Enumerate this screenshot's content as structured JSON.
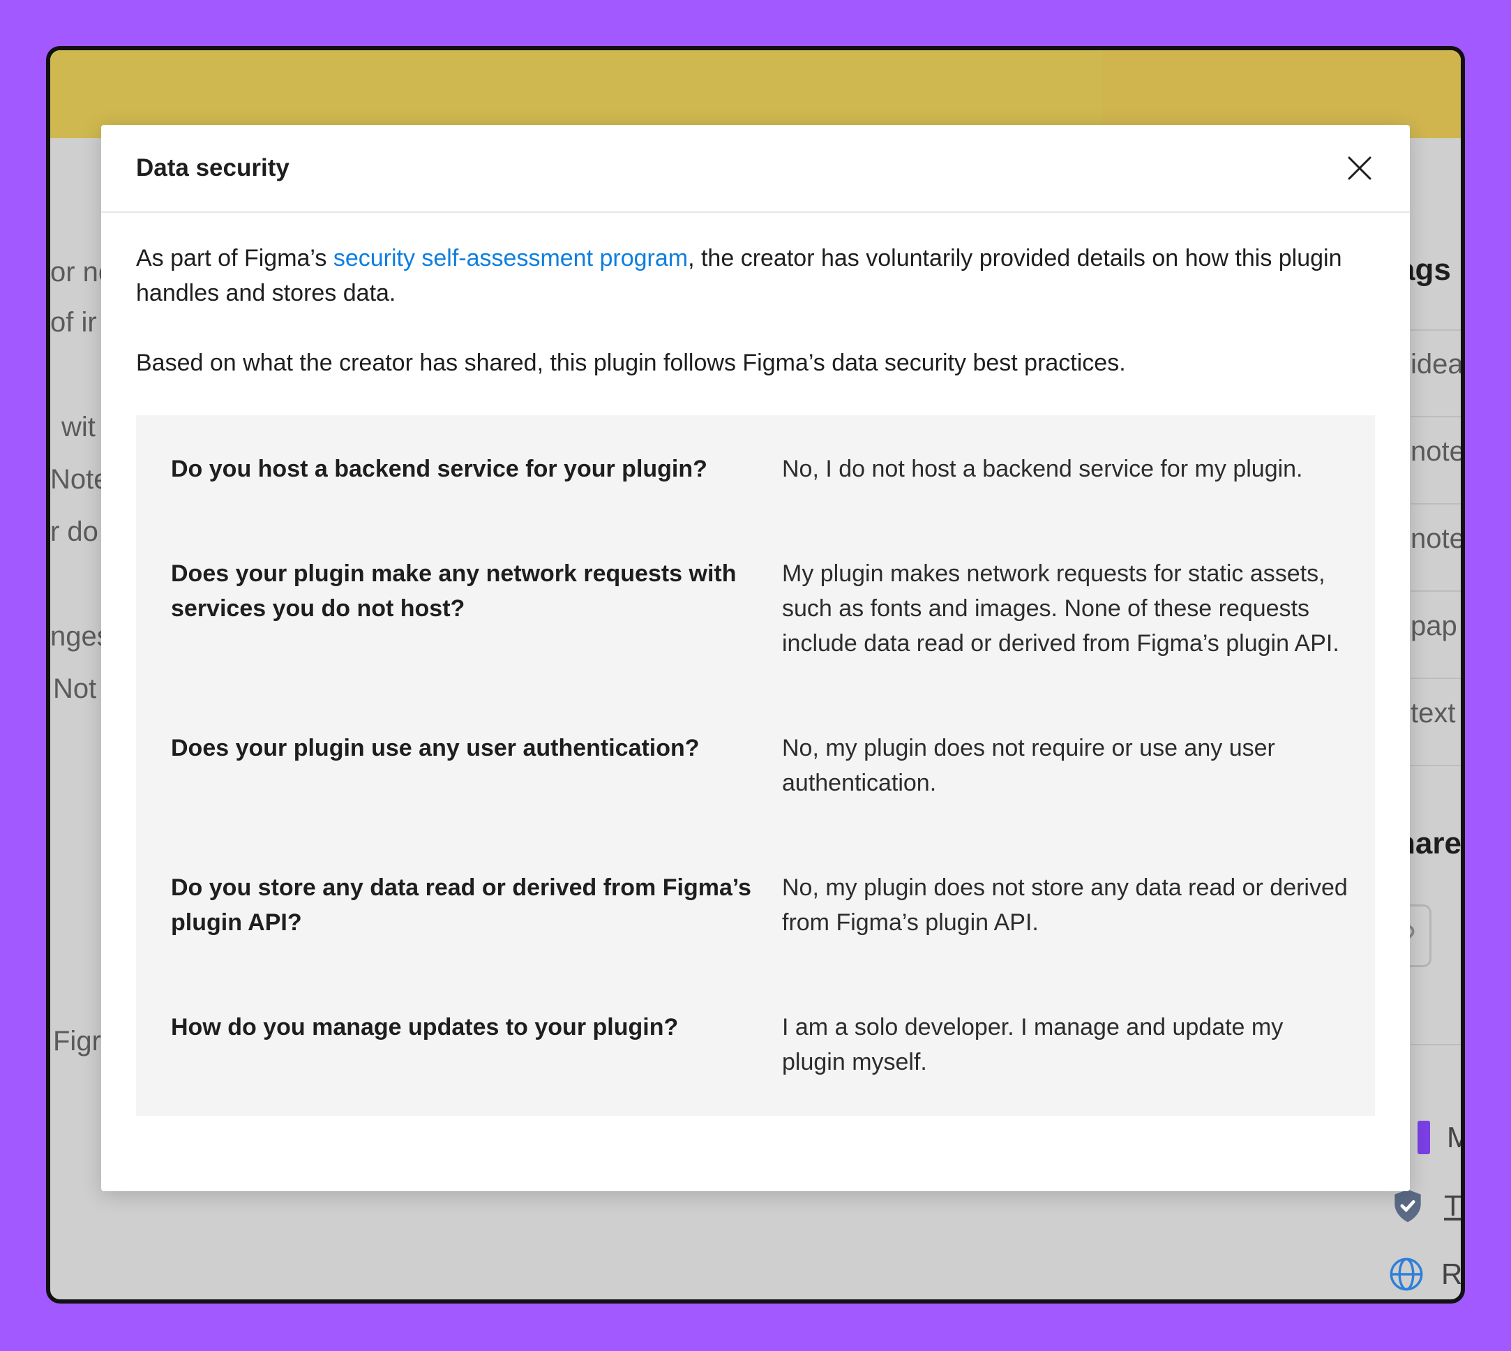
{
  "background": {
    "left_fragments": [
      "or no",
      "of ir",
      "wit",
      "Note",
      "r do",
      "nges",
      "Not",
      "Figr"
    ],
    "right_fragments": {
      "heading_tags": "ags",
      "items": [
        "idea",
        "note",
        "note",
        "pap",
        "text"
      ],
      "heading_share": "hare",
      "footer_items": [
        "M",
        "Tr",
        "Re"
      ]
    }
  },
  "modal": {
    "title": "Data security",
    "intro_prefix": "As part of Figma’s ",
    "intro_link": "security self-assessment program",
    "intro_suffix": ", the creator has voluntarily provided details on how this plugin handles and stores data.",
    "summary": "Based on what the creator has shared, this plugin follows Figma’s data security best practices.",
    "qa": [
      {
        "question": "Do you host a backend service for your plugin?",
        "answer": "No, I do not host a backend service for my plugin."
      },
      {
        "question": "Does your plugin make any network requests with services you do not host?",
        "answer": "My plugin makes network requests for static assets, such as fonts and images. None of these requests include data read or derived from Figma’s plugin API."
      },
      {
        "question": "Does your plugin use any user authentication?",
        "answer": "No, my plugin does not require or use any user authentication."
      },
      {
        "question": "Do you store any data read or derived from Figma’s plugin API?",
        "answer": "No, my plugin does not store any data read or derived from Figma’s plugin API."
      },
      {
        "question": "How do you manage updates to your plugin?",
        "answer": "I am a solo developer. I manage and update my plugin myself."
      }
    ]
  },
  "colors": {
    "outer_background": "#a259ff",
    "banner": "#cfb84f",
    "link": "#0d7ee0",
    "qa_background": "#f4f4f4"
  },
  "icons": [
    "close-icon",
    "link-icon",
    "shield-check-icon",
    "globe-icon"
  ]
}
